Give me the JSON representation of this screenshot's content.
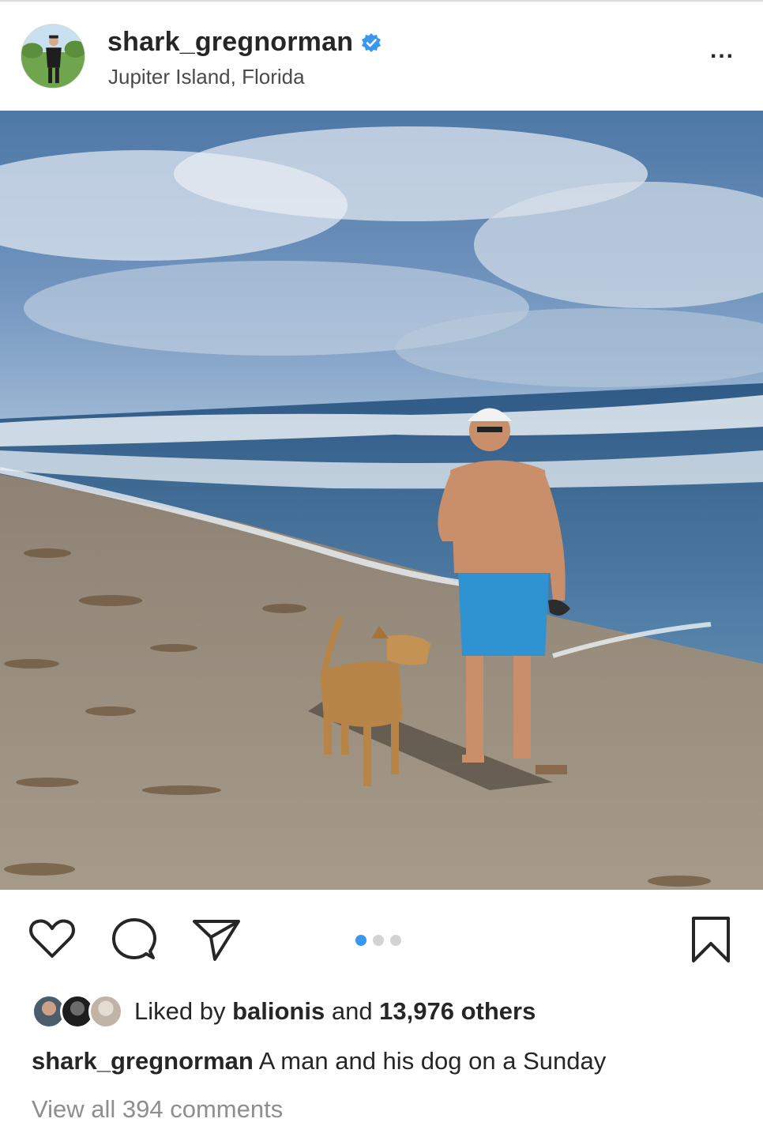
{
  "header": {
    "username": "shark_gregnorman",
    "location": "Jupiter Island, Florida",
    "more_label": "..."
  },
  "icons": {
    "avatar": "profile-avatar",
    "verified": "verified-badge-icon",
    "more": "more-options-icon",
    "like": "heart-icon",
    "comment": "comment-bubble-icon",
    "share": "paper-plane-icon",
    "save": "bookmark-icon"
  },
  "carousel": {
    "total": 3,
    "active_index": 0
  },
  "likes": {
    "prefix": "Liked by ",
    "user": "balionis",
    "middle": " and ",
    "count": "13,976 others"
  },
  "caption": {
    "username": "shark_gregnorman",
    "text": " A man and his dog on a Sunday"
  },
  "comments": {
    "view_all": "View all 394 comments"
  },
  "colors": {
    "verified": "#3897f0",
    "carousel_active": "#3897f0",
    "carousel_inactive": "#d3d3d3",
    "muted_text": "#8e8e8e"
  }
}
